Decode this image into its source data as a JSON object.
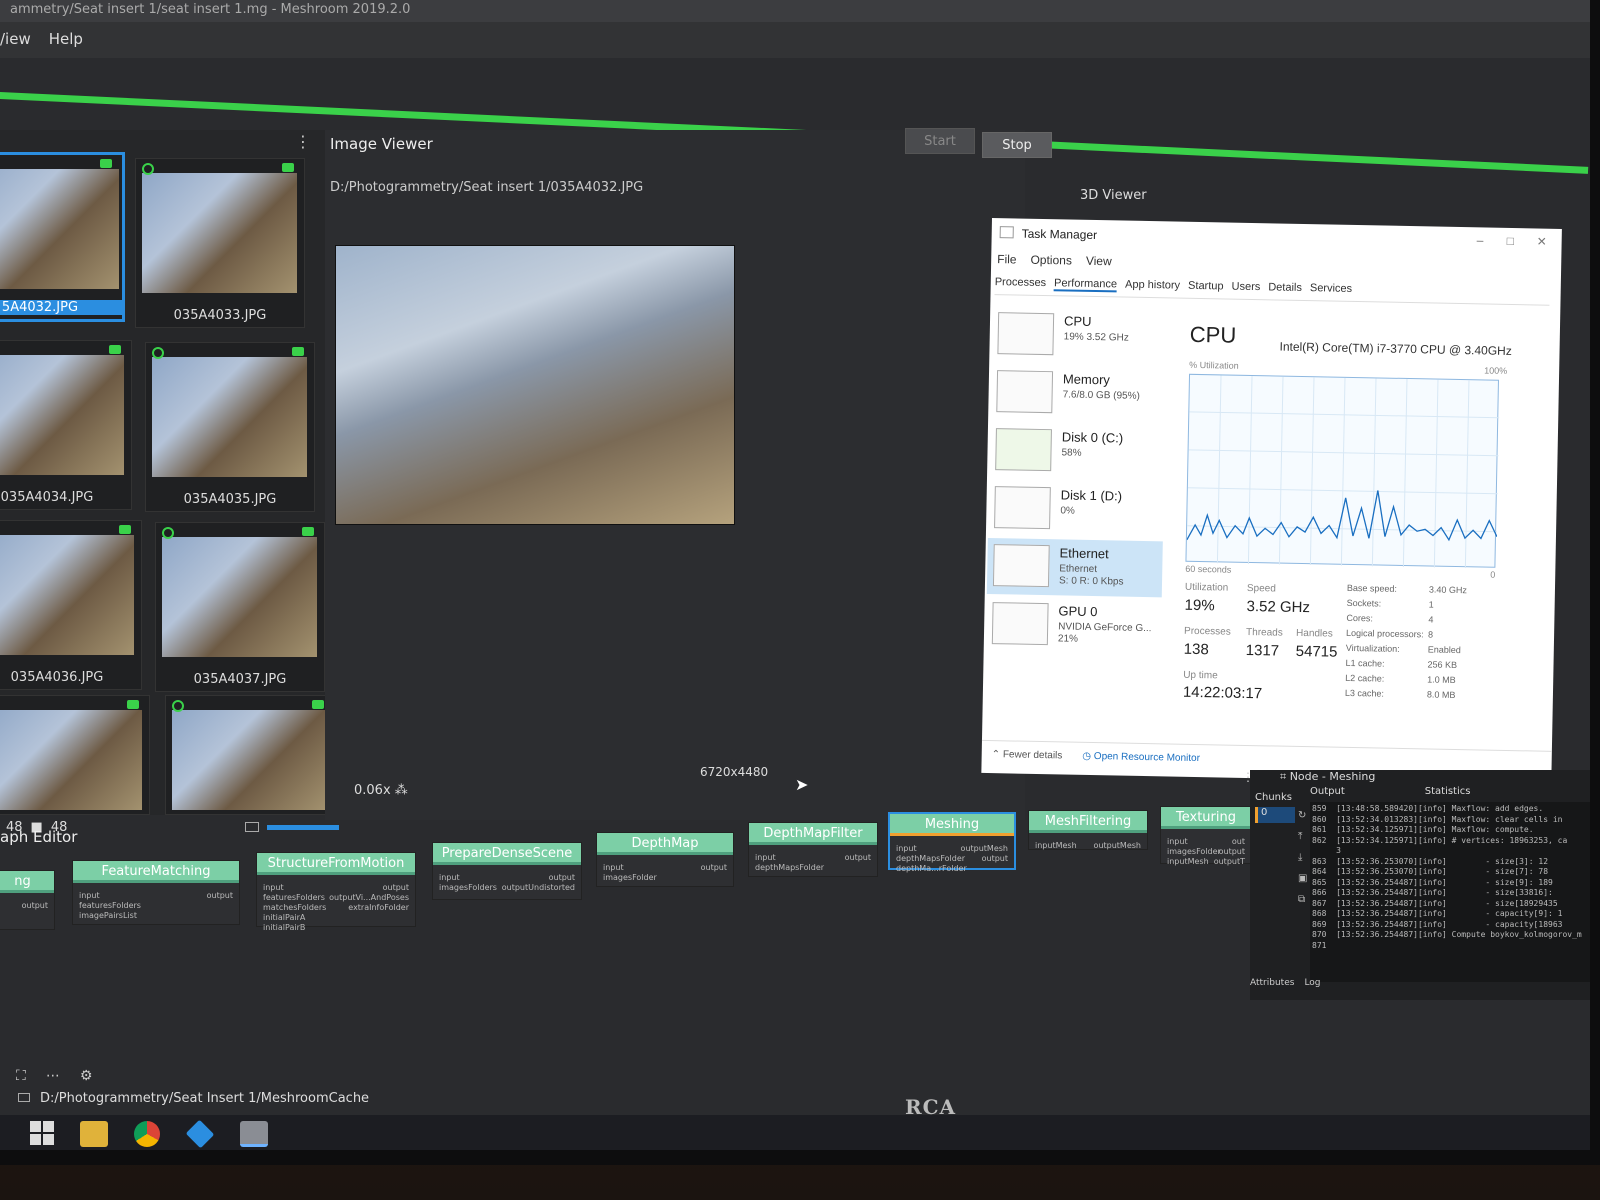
{
  "window": {
    "title": "ammetry/Seat insert 1/seat insert 1.mg - Meshroom 2019.2.0"
  },
  "menu": {
    "items": [
      "/iew",
      "Help"
    ]
  },
  "toolbar": {
    "start_label": "Start",
    "stop_label": "Stop"
  },
  "gallery": {
    "images": [
      "5A4032.JPG",
      "035A4033.JPG",
      "035A4034.JPG",
      "035A4035.JPG",
      "035A4036.JPG",
      "035A4037.JPG",
      "",
      ""
    ],
    "count_images": "48",
    "count_cameras": "48"
  },
  "viewer": {
    "title": "Image Viewer",
    "path": "D:/Photogrammetry/Seat insert 1/035A4032.JPG",
    "resolution": "6720x4480",
    "zoom": "0.06x",
    "viewer3d_title": "3D Viewer"
  },
  "taskmanager": {
    "title": "Task Manager",
    "menu": [
      "File",
      "Options",
      "View"
    ],
    "tabs": [
      "Processes",
      "Performance",
      "App history",
      "Startup",
      "Users",
      "Details",
      "Services"
    ],
    "items": [
      {
        "name": "CPU",
        "sub1": "19% 3.52 GHz",
        "sub2": ""
      },
      {
        "name": "Memory",
        "sub1": "7.6/8.0 GB (95%)",
        "sub2": ""
      },
      {
        "name": "Disk 0 (C:)",
        "sub1": "58%",
        "sub2": ""
      },
      {
        "name": "Disk 1 (D:)",
        "sub1": "0%",
        "sub2": ""
      },
      {
        "name": "Ethernet",
        "sub1": "Ethernet",
        "sub2": "S: 0 R: 0 Kbps"
      },
      {
        "name": "GPU 0",
        "sub1": "NVIDIA GeForce G...",
        "sub2": "21%"
      }
    ],
    "cpu_header": "CPU",
    "cpu_model": "Intel(R) Core(TM) i7-3770 CPU @ 3.40GHz",
    "util_label": "% Utilization",
    "util_max": "100%",
    "sixty_seconds": "60 seconds",
    "zero": "0",
    "stats": {
      "utilization_label": "Utilization",
      "utilization": "19%",
      "speed_label": "Speed",
      "speed": "3.52 GHz",
      "processes_label": "Processes",
      "processes": "138",
      "threads_label": "Threads",
      "threads": "1317",
      "handles_label": "Handles",
      "handles": "54715",
      "uptime_label": "Up time",
      "uptime": "14:22:03:17"
    },
    "specs": [
      [
        "Base speed:",
        "3.40 GHz"
      ],
      [
        "Sockets:",
        "1"
      ],
      [
        "Cores:",
        "4"
      ],
      [
        "Logical processors:",
        "8"
      ],
      [
        "Virtualization:",
        "Enabled"
      ],
      [
        "L1 cache:",
        "256 KB"
      ],
      [
        "L2 cache:",
        "1.0 MB"
      ],
      [
        "L3 cache:",
        "8.0 MB"
      ]
    ],
    "fewer_details": "Fewer details",
    "open_monitor": "Open Resource Monitor"
  },
  "graph": {
    "title": "aph Editor",
    "nodes": [
      {
        "label": "ng",
        "inputs": "",
        "outputs": "output"
      },
      {
        "label": "FeatureMatching",
        "inputs": "input\nfeaturesFolders\nimagePairsList",
        "outputs": "output"
      },
      {
        "label": "StructureFromMotion",
        "inputs": "input\nfeaturesFolders\nmatchesFolders\ninitialPairA\ninitialPairB",
        "outputs": "output\noutputVi...AndPoses\nextraInfoFolder"
      },
      {
        "label": "PrepareDenseScene",
        "inputs": "input\nimagesFolders",
        "outputs": "output\noutputUndistorted"
      },
      {
        "label": "DepthMap",
        "inputs": "input\nimagesFolder",
        "outputs": "output"
      },
      {
        "label": "DepthMapFilter",
        "inputs": "input\ndepthMapsFolder",
        "outputs": "output"
      },
      {
        "label": "Meshing",
        "inputs": "input\ndepthMapsFolder\ndepthMa...rFolder",
        "outputs": "outputMesh\noutput"
      },
      {
        "label": "MeshFiltering",
        "inputs": "inputMesh",
        "outputs": "outputMesh"
      },
      {
        "label": "Texturing",
        "inputs": "input\nimagesFolder\ninputMesh",
        "outputs": "out\noutput\noutputT"
      }
    ]
  },
  "node_panel": {
    "title": "Node - Meshing",
    "chunks_label": "Chunks",
    "chunk_value": "0",
    "tab_output": "Output",
    "tab_statistics": "Statistics",
    "log": "859  [13:48:58.589420][info] Maxflow: add edges.\n860  [13:52:34.013283][info] Maxflow: clear cells in\n861  [13:52:34.125971][info] Maxflow: compute.\n862  [13:52:34.125971][info] # vertices: 18963253, ca\n     3\n863  [13:52:36.253070][info]        - size[3]: 12\n864  [13:52:36.253070][info]        - size[7]: 78\n865  [13:52:36.254487][info]        - size[9]: 189\n866  [13:52:36.254487][info]        - size[33816]:\n867  [13:52:36.254487][info]        - size[18929435\n868  [13:52:36.254487][info]        - capacity[9]: 1\n869  [13:52:36.254487][info]        - capacity[18963\n870  [13:52:36.254487][info] Compute boykov_kolmogorov_m\n871",
    "tab_attributes": "Attributes",
    "tab_log": "Log"
  },
  "footer": {
    "path": "D:/Photogrammetry/Seat Insert 1/MeshroomCache"
  },
  "brand": "RCA"
}
